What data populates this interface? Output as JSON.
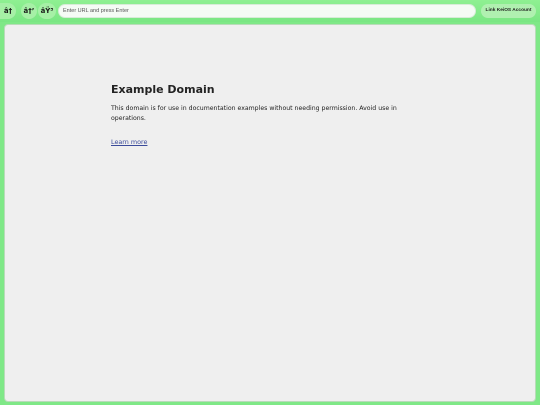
{
  "toolbar": {
    "back_label": "â†",
    "forward_label": "â†’",
    "reload_label": "âŸ³",
    "url_placeholder": "Enter URL and press Enter",
    "url_value": "",
    "link_account_label": "Link KeiOS Account"
  },
  "page": {
    "title": "Example Domain",
    "paragraph": "This domain is for use in documentation examples without needing permission. Avoid use in operations.",
    "link_text": "Learn more"
  },
  "colors": {
    "toolbar_bg": "#7fe887",
    "content_bg": "#efefef",
    "link": "#3a4a9a"
  }
}
